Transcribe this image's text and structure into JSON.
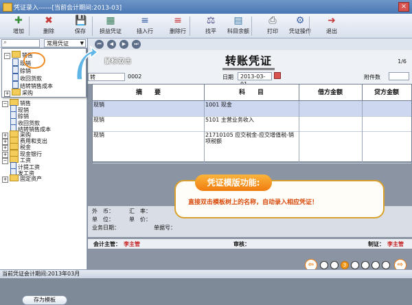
{
  "window": {
    "title": "凭证录入------[当前会计期间:2013-03]",
    "close_label": "×"
  },
  "toolbar": [
    {
      "label": "增加",
      "icon": "✚",
      "color": "#3a8d3a"
    },
    {
      "label": "删除",
      "icon": "✖",
      "color": "#c83a3a"
    },
    {
      "label": "保存",
      "icon": "💾",
      "color": "#3a5fa8"
    },
    {
      "label": "损益凭证",
      "icon": "▦",
      "color": "#3a7d5a"
    },
    {
      "label": "插入行",
      "icon": "≡",
      "color": "#3a5fa8"
    },
    {
      "label": "删除行",
      "icon": "≡",
      "color": "#c83a3a"
    },
    {
      "label": "找平",
      "icon": "⚖",
      "color": "#4a4a8a"
    },
    {
      "label": "科目余额",
      "icon": "▤",
      "color": "#3a7aa8"
    },
    {
      "label": "打印",
      "icon": "⎙",
      "color": "#555555"
    },
    {
      "label": "凭证操作",
      "icon": "⚙",
      "color": "#3a5fa8"
    },
    {
      "label": "退出",
      "icon": "➜",
      "color": "#c83a3a"
    }
  ],
  "left": {
    "search_placeholder": "",
    "common_label": "常用凭证",
    "tree": [
      {
        "label": "销售",
        "type": "folder",
        "expanded": true,
        "level": 0
      },
      {
        "label": "现销",
        "type": "doc",
        "level": 1
      },
      {
        "label": "赊销",
        "type": "doc",
        "level": 1
      },
      {
        "label": "收回货款",
        "type": "doc",
        "level": 1
      },
      {
        "label": "结转销售成本",
        "type": "doc",
        "level": 1
      },
      {
        "label": "采购",
        "type": "folder",
        "expanded": false,
        "level": 0
      },
      {
        "label": "费用和支出",
        "type": "folder",
        "expanded": false,
        "level": 0
      },
      {
        "label": "税金",
        "type": "folder",
        "expanded": false,
        "level": 0
      },
      {
        "label": "现金银行",
        "type": "folder",
        "expanded": false,
        "level": 0
      },
      {
        "label": "工资",
        "type": "folder",
        "expanded": true,
        "level": 0
      },
      {
        "label": "计提工资",
        "type": "doc",
        "level": 1
      },
      {
        "label": "发工资",
        "type": "doc",
        "level": 1
      },
      {
        "label": "固定资产",
        "type": "folder",
        "expanded": false,
        "level": 0
      }
    ],
    "save_template": "存为模板"
  },
  "voucher": {
    "title": "转账凭证",
    "page": "1/6",
    "word": "转",
    "number": "0002",
    "date_label": "日期",
    "date": "2013-03-01",
    "attach_label": "附件数",
    "columns": [
      "摘　　要",
      "科　　目",
      "借方金额",
      "贷方金额"
    ],
    "rows": [
      {
        "summary": "现销",
        "account": "1001 现金",
        "debit": "",
        "credit": ""
      },
      {
        "summary": "现销",
        "account": "5101 主营业务收入",
        "debit": "",
        "credit": ""
      },
      {
        "summary": "现销",
        "account": "21710105 应交税金-应交增值税-销项税额",
        "debit": "",
        "credit": ""
      }
    ],
    "info": {
      "currency": "外　币：",
      "rate": "汇　率：",
      "unit": "单　位：",
      "price": "单　价：",
      "biz_date": "业务日期：",
      "doc_no": "单据号："
    },
    "sign": {
      "supervisor_label": "会计主管：",
      "supervisor": "李主管",
      "audit_label": "审核：",
      "maker_label": "制证：",
      "maker": "李主管"
    }
  },
  "hint": "鼠标双击",
  "banner": {
    "title": "凭证模版功能:",
    "text": "直接双击模板树上的名称，自动录入相应凭证！"
  },
  "pager": {
    "current": "3"
  },
  "status": "当前凭证会计期间:2013年03月"
}
